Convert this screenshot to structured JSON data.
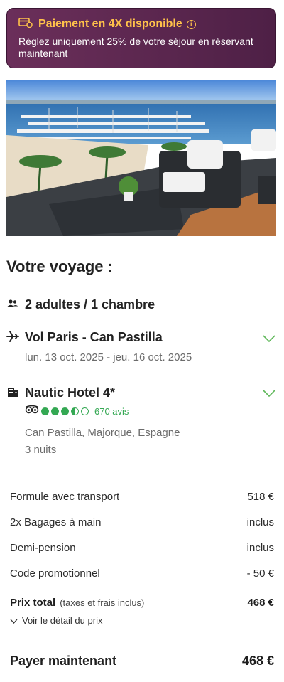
{
  "banner": {
    "title": "Paiement en 4X disponible",
    "text": "Réglez uniquement 25% de votre séjour en réservant maintenant",
    "title_color": "#ffc24a",
    "bg_color": "#5c2750"
  },
  "trip": {
    "section_title": "Votre voyage :",
    "travellers": "2 adultes / 1 chambre",
    "flight": {
      "title": "Vol Paris - Can Pastilla",
      "dates": "lun. 13 oct. 2025 - jeu. 16 oct. 2025"
    },
    "hotel": {
      "name": "Nautic Hotel 4*",
      "rating": 3.5,
      "rating_max": 5,
      "reviews": "670 avis",
      "location": "Can Pastilla, Majorque, Espagne",
      "nights": "3 nuits"
    }
  },
  "pricing": {
    "rows": [
      {
        "label": "Formule avec transport",
        "value": "518 €"
      },
      {
        "label": "2x Bagages à main",
        "value": "inclus"
      },
      {
        "label": "Demi-pension",
        "value": "inclus"
      },
      {
        "label": "Code promotionnel",
        "value": "- 50 €"
      }
    ],
    "total_label": "Prix total",
    "total_note": "(taxes et frais inclus)",
    "total_value": "468 €",
    "detail_link": "Voir le détail du prix",
    "pay_now_label": "Payer maintenant",
    "pay_now_value": "468 €"
  },
  "accent_green": "#34a853"
}
